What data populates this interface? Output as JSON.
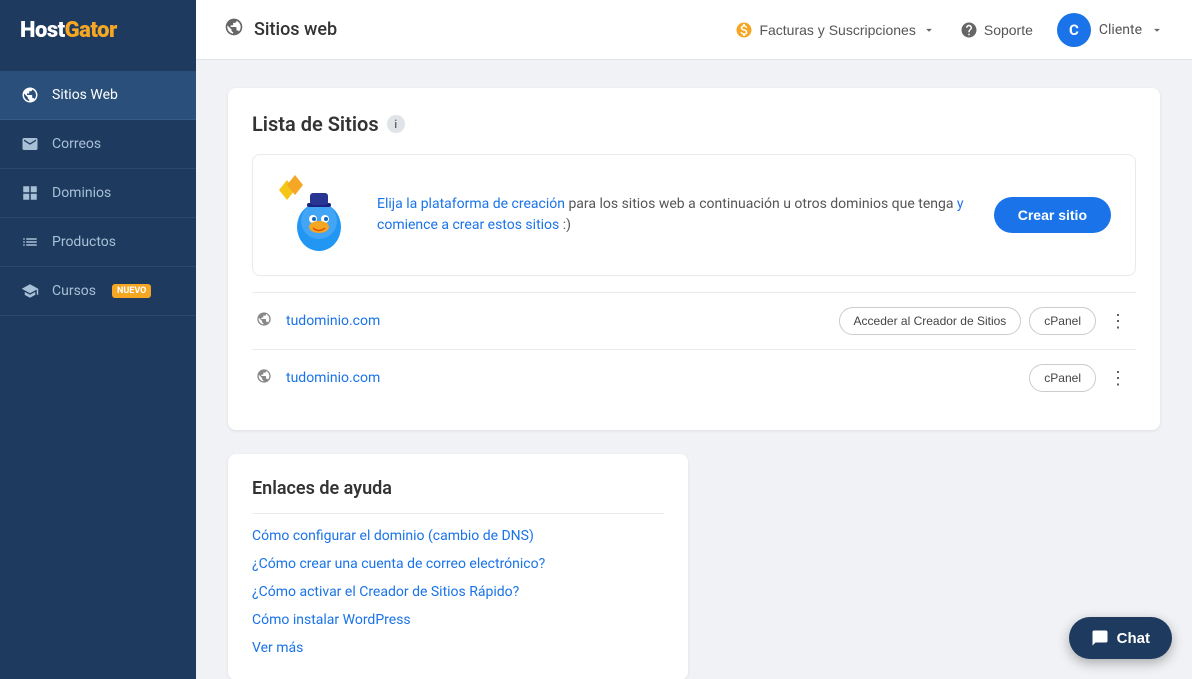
{
  "sidebar": {
    "logo": {
      "host": "Host",
      "gator": "Gator"
    },
    "items": [
      {
        "id": "sitios-web",
        "label": "Sitios Web",
        "icon": "globe",
        "active": true,
        "badge": null
      },
      {
        "id": "correos",
        "label": "Correos",
        "icon": "email",
        "active": false,
        "badge": null
      },
      {
        "id": "dominios",
        "label": "Dominios",
        "icon": "grid",
        "active": false,
        "badge": null
      },
      {
        "id": "productos",
        "label": "Productos",
        "icon": "list",
        "active": false,
        "badge": null
      },
      {
        "id": "cursos",
        "label": "Cursos",
        "icon": "star",
        "active": false,
        "badge": "NUEVO"
      }
    ]
  },
  "header": {
    "page_title": "Sitios web",
    "facturas_label": "Facturas y Suscripciones",
    "soporte_label": "Soporte",
    "cliente_label": "Cliente",
    "cliente_initial": "C"
  },
  "main": {
    "section_title": "Lista de Sitios",
    "banner": {
      "text_plain": " para los sitios web a continuación u otros dominios que tenga ",
      "link1": "Elija la plataforma de creación",
      "link2": "y comience a crear estos sitios",
      "emoji": ":)",
      "btn_label": "Crear sitio"
    },
    "domains": [
      {
        "name": "tudominio.com",
        "btn_acceder": "Acceder al Creador de Sitios",
        "btn_cpanel": "cPanel"
      },
      {
        "name": "tudominio.com",
        "btn_acceder": null,
        "btn_cpanel": "cPanel"
      }
    ],
    "help": {
      "title": "Enlaces de ayuda",
      "links": [
        "Cómo configurar el dominio (cambio de DNS)",
        "¿Cómo crear una cuenta de correo electrónico?",
        "¿Cómo activar el Creador de Sitios Rápido?",
        "Cómo instalar WordPress",
        "Ver más"
      ]
    }
  },
  "chat": {
    "label": "Chat"
  }
}
